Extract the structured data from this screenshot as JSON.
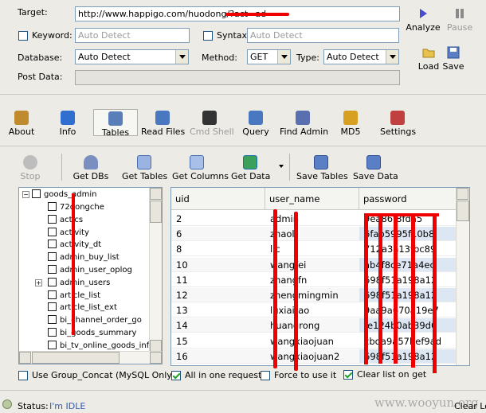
{
  "target": {
    "label": "Target:",
    "url": "http://www.happigo.com/huodong/?act=ad"
  },
  "keyword": {
    "label": "Keyword:",
    "placeholder": "Auto Detect"
  },
  "syntax": {
    "label": "Syntax:",
    "placeholder": "Auto Detect"
  },
  "database": {
    "label": "Database:",
    "value": "Auto Detect"
  },
  "method": {
    "label": "Method:",
    "value": "GET"
  },
  "type": {
    "label": "Type:",
    "value": "Auto Detect"
  },
  "post_data": {
    "label": "Post Data:"
  },
  "side_buttons": {
    "analyze": "Analyze",
    "pause": "Pause",
    "load": "Load",
    "save": "Save"
  },
  "nav": [
    {
      "label": "About",
      "icon": "about-icon",
      "color": "#c08a2e"
    },
    {
      "label": "Info",
      "icon": "info-icon",
      "color": "#2f6fd0"
    },
    {
      "label": "Tables",
      "icon": "tables-icon",
      "color": "#5a7fb8"
    },
    {
      "label": "Read Files",
      "icon": "read-files-icon",
      "color": "#4a78c0"
    },
    {
      "label": "Cmd Shell",
      "icon": "cmd-shell-icon",
      "color": "#333333"
    },
    {
      "label": "Query",
      "icon": "query-icon",
      "color": "#4a78c0"
    },
    {
      "label": "Find Admin",
      "icon": "find-admin-icon",
      "color": "#5a6fb0"
    },
    {
      "label": "MD5",
      "icon": "md5-icon",
      "color": "#d8a020"
    },
    {
      "label": "Settings",
      "icon": "settings-icon",
      "color": "#c04040"
    }
  ],
  "toolbar": {
    "stop": "Stop",
    "get_dbs": "Get DBs",
    "get_tables": "Get Tables",
    "get_columns": "Get Columns",
    "get_data": "Get Data",
    "save_tables": "Save Tables",
    "save_data": "Save Data"
  },
  "tree": {
    "root": "goods_admin",
    "items": [
      "72dongche",
      "actics",
      "activity",
      "activity_dt",
      "admin_buy_list",
      "admin_user_oplog",
      "admin_users",
      "article_list",
      "article_list_ext",
      "bi_channel_order_go",
      "bi_goods_summary",
      "bi_tv_online_goods_info"
    ]
  },
  "grid": {
    "columns": [
      "uid",
      "user_name",
      "password"
    ],
    "rows": [
      {
        "uid": "2",
        "user_name": "admin",
        "password": "9ea86f8fda5"
      },
      {
        "uid": "6",
        "user_name": "zhaoli",
        "password": "6fab5995f10b8"
      },
      {
        "uid": "8",
        "user_name": "lic",
        "password": "712a3a13fbc89"
      },
      {
        "uid": "10",
        "user_name": "wangfei",
        "password": "ab4f8ce71a4ec"
      },
      {
        "uid": "11",
        "user_name": "zhangfn",
        "password": "698f51a198a12"
      },
      {
        "uid": "12",
        "user_name": "zhengmingmin",
        "password": "698f51a198a12"
      },
      {
        "uid": "13",
        "user_name": "luxiaitao",
        "password": "9aa9a670a19e7"
      },
      {
        "uid": "14",
        "user_name": "huangrong",
        "password": "fe124b0ab39d6"
      },
      {
        "uid": "15",
        "user_name": "wangxiaojuan",
        "password": "cbda9a57bef9ad"
      },
      {
        "uid": "16",
        "user_name": "wangxiaojuan2",
        "password": "698f51a198a12"
      }
    ]
  },
  "options": {
    "group_concat": "Use Group_Concat (MySQL Only)",
    "all_in_one": "All in one request.",
    "force": "Force to use it",
    "clear_list": "Clear list on get"
  },
  "status": {
    "label": "Status:",
    "value": "I'm IDLE",
    "clear_log": "Clear Log"
  },
  "watermark": "www.wooyun.org",
  "colors": {
    "accent": "#2f5bb5",
    "window_bg": "#ecebe6",
    "redaction": "#e00000"
  }
}
